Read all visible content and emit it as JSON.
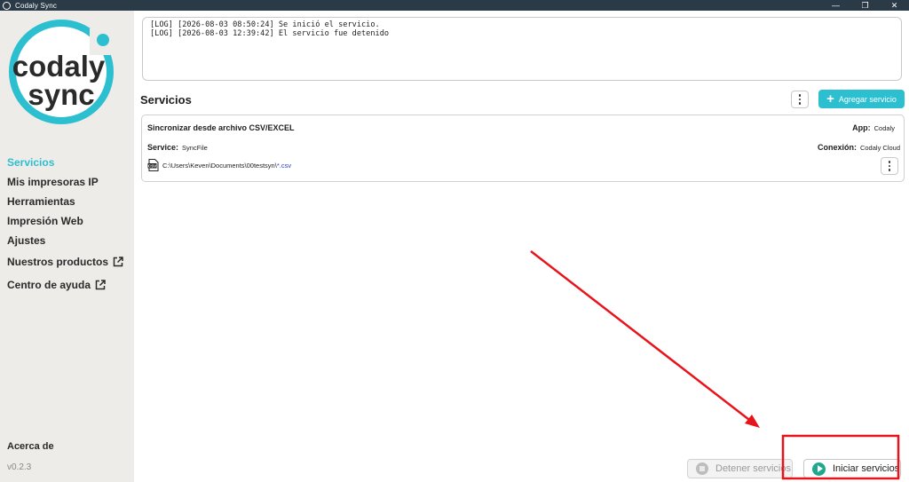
{
  "window": {
    "title": "Codaly Sync",
    "controls": [
      "—",
      "❐",
      "✕"
    ]
  },
  "sidebar": {
    "logo_text": [
      "codaly",
      "sync"
    ],
    "items": [
      {
        "label": "Servicios",
        "active": true
      },
      {
        "label": "Mis impresoras IP"
      },
      {
        "label": "Herramientas"
      },
      {
        "label": "Impresión Web"
      },
      {
        "label": "Ajustes"
      },
      {
        "label": "Nuestros productos",
        "external": true
      },
      {
        "label": "Centro de ayuda",
        "external": true
      }
    ],
    "about": "Acerca de",
    "version": "v0.2.3"
  },
  "log": {
    "lines": [
      "[LOG] [2026-08-03 08:50:24] Se inició el servicio.",
      "[LOG] [2026-08-03 12:39:42] El servicio fue detenido"
    ]
  },
  "services": {
    "title": "Servicios",
    "add_label": "Agregar servicio",
    "card": {
      "title": "Sincronizar desde archivo CSV/EXCEL",
      "service_label": "Service:",
      "service_value": "SyncFile",
      "app_label": "App:",
      "app_value": "Codaly",
      "connection_label": "Conexión:",
      "connection_value": "Codaly Cloud",
      "file_icon_text": "CSV",
      "path": "C:\\Users\\Keven\\Documents\\00testsyn\\",
      "path_ext": "*.csv"
    }
  },
  "footer": {
    "stop_label": "Detener servicios",
    "start_label": "Iniciar servicios"
  },
  "colors": {
    "accent": "#2bbfd0",
    "sidebar_bg": "#eeece9",
    "start_icon": "#1fa88d",
    "annotation": "#e8141c"
  }
}
